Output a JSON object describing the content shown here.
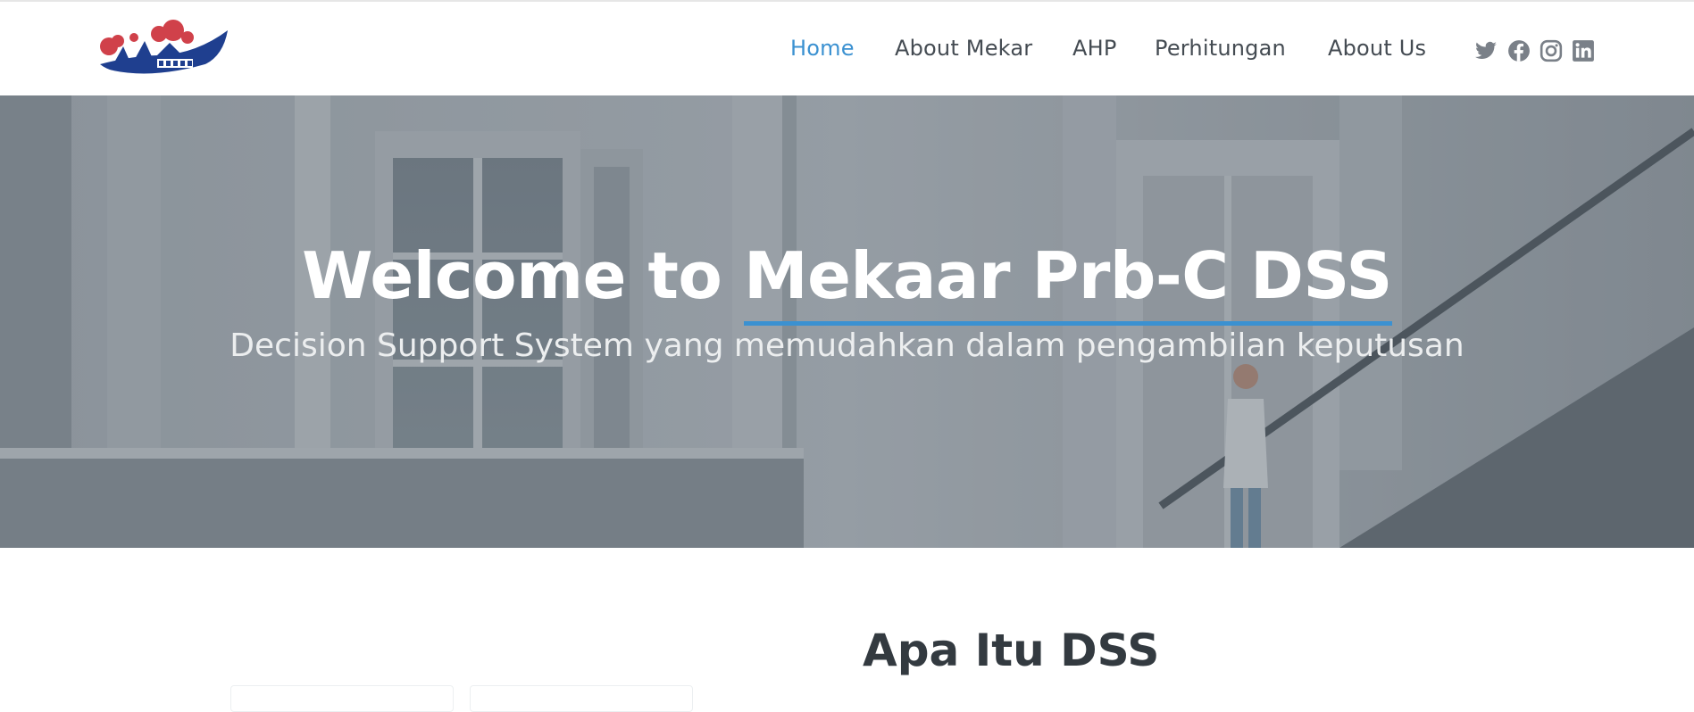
{
  "nav": {
    "items": [
      {
        "label": "Home",
        "active": true
      },
      {
        "label": "About Mekar",
        "active": false
      },
      {
        "label": "AHP",
        "active": false
      },
      {
        "label": "Perhitungan",
        "active": false
      },
      {
        "label": "About Us",
        "active": false
      }
    ],
    "social": [
      "twitter-icon",
      "facebook-icon",
      "instagram-icon",
      "linkedin-icon"
    ]
  },
  "hero": {
    "title_part1": "Welcome to ",
    "title_part2": "Mekaar Prb-C DSS",
    "subtitle": "Decision Support System yang memudahkan dalam pengambilan keputusan"
  },
  "about": {
    "title": "Apa Itu DSS"
  },
  "colors": {
    "accent": "#3b91d1",
    "nav_text": "#444b52",
    "logo_blue": "#1f3f8f",
    "logo_red": "#d0414a"
  }
}
